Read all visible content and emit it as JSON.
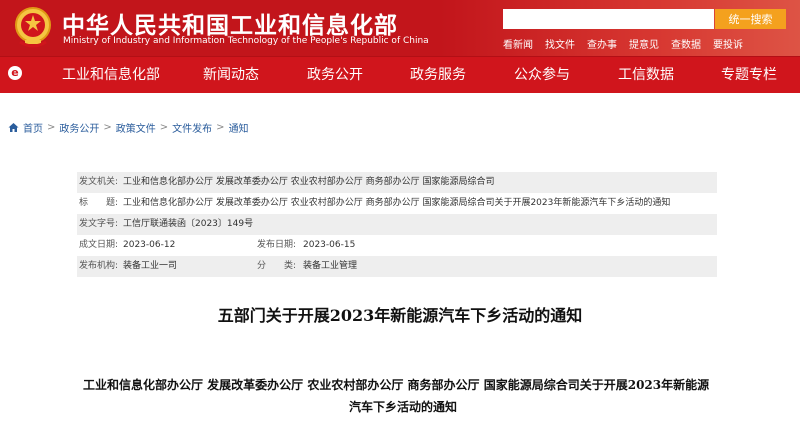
{
  "header": {
    "site_name": "中华人民共和国工业和信息化部",
    "site_name_en": "Ministry of Industry and Information Technology of the People's Republic of China",
    "search_placeholder": "",
    "search_button": "统一搜索",
    "links": [
      "看新闻",
      "找文件",
      "查办事",
      "提意见",
      "查数据",
      "要投诉"
    ]
  },
  "nav": {
    "logo_letter": "e",
    "items": [
      "工业和信息化部",
      "新闻动态",
      "政务公开",
      "政务服务",
      "公众参与",
      "工信数据",
      "专题专栏"
    ]
  },
  "breadcrumb": {
    "items": [
      "首页",
      "政务公开",
      "政策文件",
      "文件发布",
      "通知"
    ],
    "separator": ">"
  },
  "meta": {
    "issuer_label": "发文机关:",
    "issuer": "工业和信息化部办公厅 发展改革委办公厅 农业农村部办公厅 商务部办公厅 国家能源局综合司",
    "title_label": "标　　题:",
    "title": "工业和信息化部办公厅 发展改革委办公厅 农业农村部办公厅 商务部办公厅 国家能源局综合司关于开展2023年新能源汽车下乡活动的通知",
    "doc_no_label": "发文字号:",
    "doc_no": "工信厅联通装函〔2023〕149号",
    "date_label": "成文日期:",
    "date": "2023-06-12",
    "publish_label": "发布日期:",
    "publish_date": "2023-06-15",
    "org_label": "发布机构:",
    "org": "装备工业一司",
    "category_label": "分　　类:",
    "category": "装备工业管理"
  },
  "document": {
    "title": "五部门关于开展2023年新能源汽车下乡活动的通知",
    "recipients_line1": "工业和信息化部办公厅 发展改革委办公厅 农业农村部办公厅 商务部办公厅 国家能源局综合司关于开展2023年新能源",
    "recipients_line2": "汽车下乡活动的通知"
  },
  "colors": {
    "header_red": "#c2151b",
    "nav_red": "#d0151c",
    "search_button": "#f4a11e",
    "link_blue": "#2b5d9c"
  },
  "icons": {
    "emblem": "national-emblem-icon",
    "home": "home-icon"
  }
}
